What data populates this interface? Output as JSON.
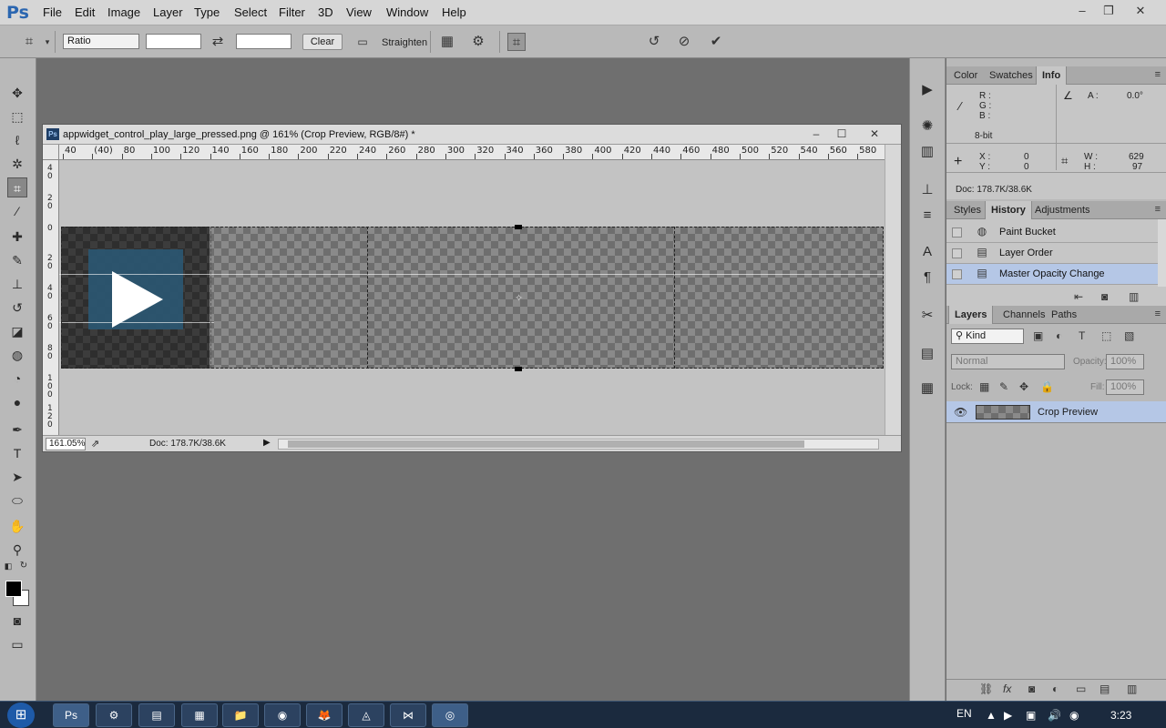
{
  "app": {
    "logo": "Ps",
    "menu": [
      "File",
      "Edit",
      "Image",
      "Layer",
      "Type",
      "Select",
      "Filter",
      "3D",
      "View",
      "Window",
      "Help"
    ],
    "window_controls": {
      "minimize": "–",
      "restore": "❐",
      "close": "✕"
    }
  },
  "options_bar": {
    "crop_tool_icon": "crop-icon",
    "ratio_select": "Ratio",
    "width_value": "",
    "height_value": "",
    "swap_icon": "⇄",
    "clear_label": "Clear",
    "straighten_label": "Straighten",
    "reset_icon": "↺",
    "cancel_icon": "⃠",
    "commit_icon": "✔"
  },
  "document": {
    "ps_icon": "Ps",
    "title": "appwidget_control_play_large_pressed.png @ 161% (Crop Preview, RGB/8#) *",
    "zoom": "161.05%",
    "doc_info": "Doc: 178.7K/38.6K",
    "ruler_h": [
      "40",
      "(40)",
      "80",
      "100",
      "120",
      "140",
      "160",
      "180",
      "200",
      "220",
      "240",
      "260",
      "280",
      "300",
      "320",
      "340",
      "360",
      "380",
      "400",
      "420",
      "440",
      "460",
      "480",
      "500",
      "520",
      "540",
      "560",
      "580"
    ],
    "ruler_v": [
      "4\n0",
      "2\n0",
      "0",
      "2\n0",
      "4\n0",
      "6\n0",
      "8\n0",
      "1\n0\n0",
      "1\n2\n0"
    ]
  },
  "panels": {
    "top_tabs": [
      "Color",
      "Swatches",
      "Info"
    ],
    "info": {
      "r": "R :",
      "g": "G :",
      "b": "B :",
      "bit": "8-bit",
      "a_label": "A :",
      "a_value": "0.0°",
      "x_label": "X :",
      "x_value": "0",
      "y_label": "Y :",
      "y_value": "0",
      "w_label": "W :",
      "w_value": "629",
      "h_label": "H :",
      "h_value": "97",
      "doc": "Doc: 178.7K/38.6K"
    },
    "history_tabs": [
      "Styles",
      "History",
      "Adjustments"
    ],
    "history": [
      {
        "label": "Paint Bucket",
        "icon": "paint-bucket-icon",
        "selected": false
      },
      {
        "label": "Layer Order",
        "icon": "history-state-icon",
        "selected": false
      },
      {
        "label": "Master Opacity Change",
        "icon": "history-state-icon",
        "selected": true
      }
    ],
    "layers_tabs": [
      "Layers",
      "Channels",
      "Paths"
    ],
    "layers": {
      "filter_kind": "Kind",
      "blend_mode": "Normal",
      "opacity_label": "Opacity:",
      "opacity_value": "100%",
      "lock_label": "Lock:",
      "fill_label": "Fill:",
      "fill_value": "100%",
      "items": [
        {
          "name": "Crop Preview",
          "visible": true,
          "selected": true
        }
      ]
    }
  },
  "taskbar": {
    "items": [
      "Ps",
      "⚙",
      "▤",
      "▦",
      "📁",
      "◉",
      "🦊",
      "◬",
      "⋈",
      "◎"
    ],
    "language": "EN",
    "time": "3:23"
  },
  "colors": {
    "accent_selection": "#b5c7e6",
    "play_tile": "#2b5570",
    "ps_blue": "#2b66b0"
  }
}
